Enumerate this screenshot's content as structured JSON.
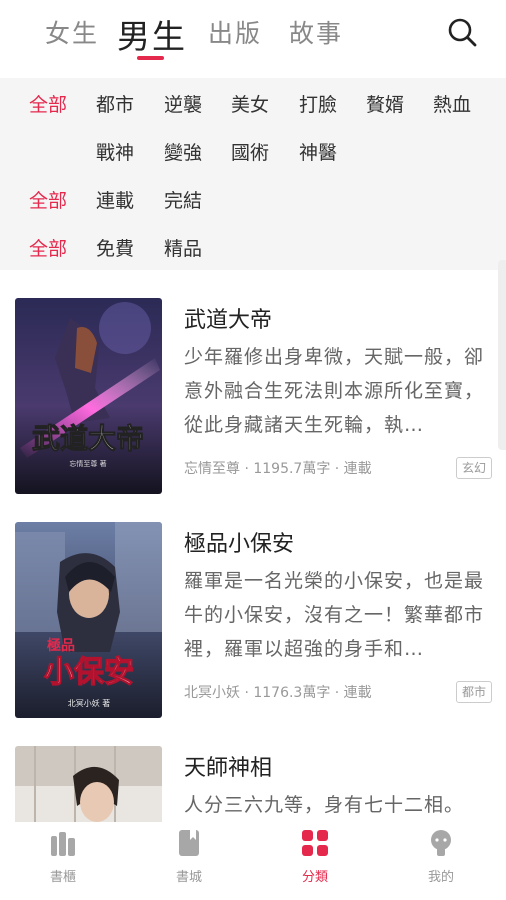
{
  "top_tabs": [
    {
      "label": "女生"
    },
    {
      "label": "男生"
    },
    {
      "label": "出版"
    },
    {
      "label": "故事"
    }
  ],
  "filters": {
    "genre": [
      "全部",
      "都市",
      "逆襲",
      "美女",
      "打臉",
      "贅婿",
      "熱血",
      "戰神",
      "變強",
      "國術",
      "神醫"
    ],
    "status": [
      "全部",
      "連載",
      "完結"
    ],
    "price": [
      "全部",
      "免費",
      "精品"
    ]
  },
  "books": [
    {
      "title": "武道大帝",
      "description": "少年羅修出身卑微，天賦一般，卻意外融合生死法則本源所化至寶，從此身藏諸天生死輪，執…",
      "meta": "忘情至尊 · 1195.7萬字 · 連載",
      "tag": "玄幻",
      "cover_title": "武道大帝",
      "cover_author": "忘情至尊 著"
    },
    {
      "title": "極品小保安",
      "description": "羅軍是一名光榮的小保安，也是最牛的小保安，沒有之一！繁華都市裡，羅軍以超強的身手和…",
      "meta": "北冥小妖 · 1176.3萬字 · 連載",
      "tag": "都市",
      "cover_title_small": "極品",
      "cover_title": "小保安",
      "cover_author": "北冥小妖 著"
    },
    {
      "title": "天師神相",
      "description": "人分三六九等，身有七十二相。"
    }
  ],
  "bottom_nav": [
    {
      "label": "書櫃"
    },
    {
      "label": "書城"
    },
    {
      "label": "分類"
    },
    {
      "label": "我的"
    }
  ],
  "colors": {
    "accent": "#e5294d"
  }
}
